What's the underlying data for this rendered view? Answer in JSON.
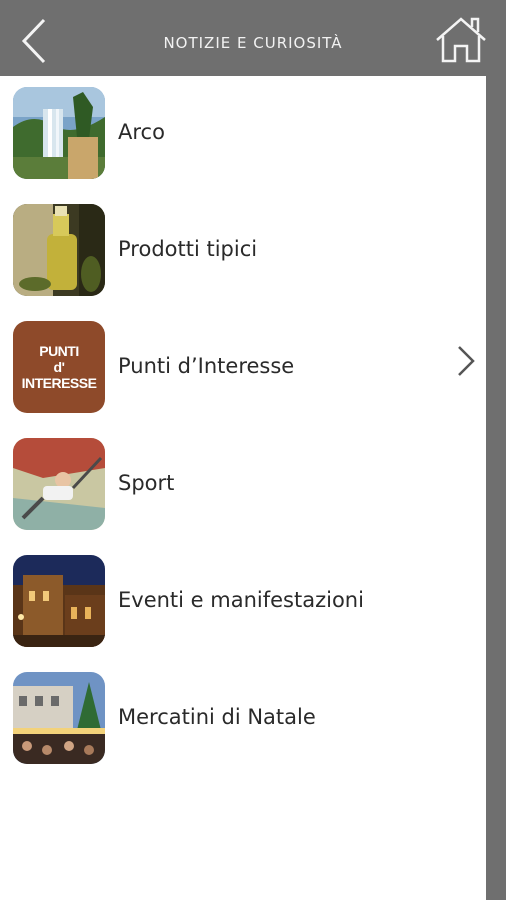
{
  "header": {
    "title": "NOTIZIE E CURIOSITÀ",
    "back_icon": "chevron-left-icon",
    "home_icon": "home-icon"
  },
  "colors": {
    "header_bg": "#6f6f6f",
    "content_bg": "#ffffff",
    "punti_tile": "#8e4a2a"
  },
  "menu": {
    "items": [
      {
        "label": "Arco",
        "thumb": "waterfall-garden-photo"
      },
      {
        "label": "Prodotti tipici",
        "thumb": "olive-oil-bottle-photo"
      },
      {
        "label": "Punti d’Interesse",
        "thumb_text": "PUNTI\nd'\nINTERESSE",
        "chevron": "chevron-right-icon"
      },
      {
        "label": "Sport",
        "thumb": "climbing-photo"
      },
      {
        "label": "Eventi e manifestazioni",
        "thumb": "evening-square-photo"
      },
      {
        "label": "Mercatini di Natale",
        "thumb": "christmas-market-photo"
      }
    ]
  }
}
